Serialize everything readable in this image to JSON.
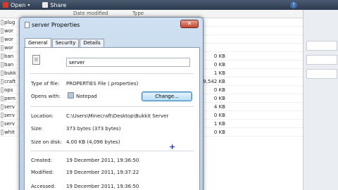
{
  "toolbar": {
    "organize_label": "Open",
    "share_label": "Share"
  },
  "list_header": {
    "date_modified": "Date modified",
    "type": "Type"
  },
  "files": [
    {
      "name": "plug",
      "size": ""
    },
    {
      "name": "wor",
      "size": ""
    },
    {
      "name": "wor",
      "size": ""
    },
    {
      "name": "wor",
      "size": ""
    },
    {
      "name": "ban",
      "size": "0 KB"
    },
    {
      "name": "ban",
      "size": "0 KB"
    },
    {
      "name": "bukk",
      "size": "1 KB"
    },
    {
      "name": "craft",
      "size": "9,542 KB"
    },
    {
      "name": "ops",
      "size": "0 KB"
    },
    {
      "name": "pern",
      "size": "0 KB"
    },
    {
      "name": "serv",
      "size": "4 KB"
    },
    {
      "name": "serv",
      "size": "0 KB"
    },
    {
      "name": "serv",
      "size": "1 KB"
    },
    {
      "name": "whit",
      "size": "0 KB"
    }
  ],
  "dialog": {
    "title": "server Properties",
    "close_symbol": "✕",
    "tabs": [
      "General",
      "Security",
      "Details"
    ],
    "file_name": "server",
    "type_label": "Type of file:",
    "type_value": "PROPERTIES File (.properties)",
    "opens_label": "Opens with:",
    "opens_value": "Notepad",
    "change_label": "Change...",
    "location_label": "Location:",
    "location_value": "C:\\Users\\Minecraft\\Desktop\\Bukkit Server",
    "size_label": "Size:",
    "size_value": "373 bytes (373 bytes)",
    "disk_label": "Size on disk:",
    "disk_value": "4.00 KB (4,096 bytes)",
    "created_label": "Created:",
    "created_value": "19 December 2011, 19:36:50",
    "modified_label": "Modified:",
    "modified_value": "19 December 2011, 19:37:22",
    "accessed_label": "Accessed:",
    "accessed_value": "19 December 2011, 19:36:50"
  }
}
